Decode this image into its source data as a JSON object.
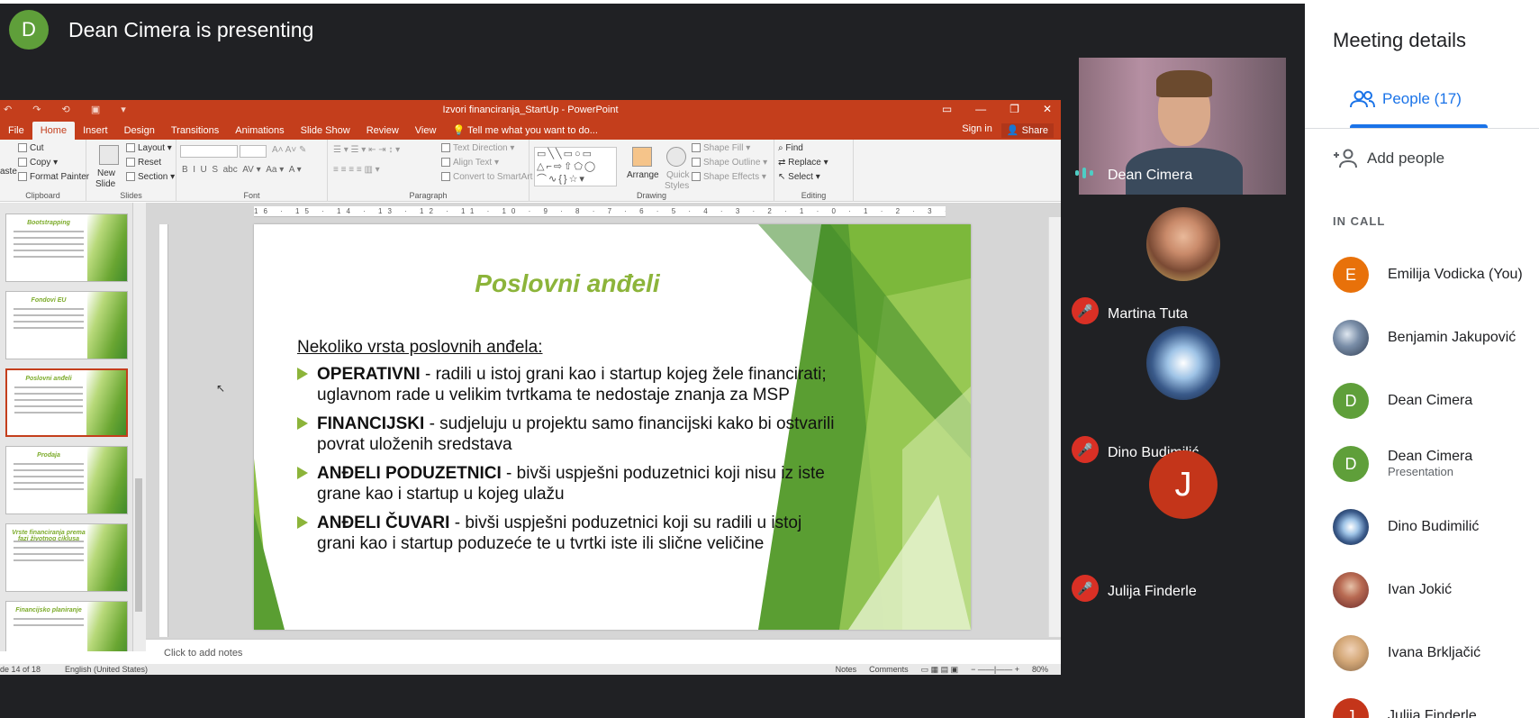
{
  "presenter": {
    "initial": "D",
    "title": "Dean Cimera is presenting"
  },
  "ppt": {
    "doc_title": "Izvori financiranja_StartUp - PowerPoint",
    "qat": "↶ ↷ ⟲ ▣ ▾",
    "tabs": [
      "File",
      "Home",
      "Insert",
      "Design",
      "Transitions",
      "Animations",
      "Slide Show",
      "Review",
      "View"
    ],
    "tell_me": "Tell me what you want to do...",
    "sign_in": "Sign in",
    "share": "Share",
    "clipboard": {
      "cut": "Cut",
      "copy": "Copy",
      "format_painter": "Format Painter",
      "paste": "aste",
      "label": "Clipboard"
    },
    "slides": {
      "new_slide": "New",
      "new_slide2": "Slide",
      "layout": "Layout",
      "reset": "Reset",
      "section": "Section",
      "label": "Slides"
    },
    "font": {
      "label": "Font"
    },
    "paragraph": {
      "text_direction": "Text Direction",
      "align_text": "Align Text",
      "convert": "Convert to SmartArt",
      "label": "Paragraph"
    },
    "drawing": {
      "arrange": "Arrange",
      "quick_styles": "Quick",
      "quick_styles2": "Styles",
      "shape_fill": "Shape Fill",
      "shape_outline": "Shape Outline",
      "shape_effects": "Shape Effects",
      "label": "Drawing"
    },
    "editing": {
      "find": "Find",
      "replace": "Replace",
      "select": "Select",
      "label": "Editing"
    },
    "ruler": "16 · 15 · 14 · 13 · 12 · 11 · 10 · 9 · 8 · 7 · 6 · 5 · 4 · 3 · 2 · 1 · 0 · 1 · 2 · 3 · 4 · 5 · 6 · 7 · 8 · 9 · 10 · 11 · 12 · 13 · 14 · 15 · 16",
    "thumbnails": [
      "Bootstrapping",
      "Fondovi EU",
      "Poslovni anđeli",
      "Prodaja",
      "Vrste financiranja prema fazi životnog ciklusa",
      "Financijsko planiranje"
    ],
    "slide": {
      "title": "Poslovni anđeli",
      "subhead": "Nekoliko vrsta poslovnih anđela:",
      "bullets": [
        {
          "head": "OPERATIVNI",
          "text": " - radili u istoj grani kao i startup kojeg žele financirati; uglavnom rade u velikim tvrtkama te nedostaje znanja za MSP"
        },
        {
          "head": "FINANCIJSKI",
          "text": " - sudjeluju u projektu samo financijski kako bi ostvarili povrat uloženih sredstava"
        },
        {
          "head": "ANĐELI PODUZETNICI",
          "text": " - bivši uspješni poduzetnici koji nisu iz iste grane kao i startup u kojeg ulažu"
        },
        {
          "head": "ANĐELI ČUVARI",
          "text": " - bivši uspješni poduzetnici koji su radili u istoj grani kao i startup poduzeće te u tvrtki iste ili slične veličine"
        }
      ]
    },
    "notes_placeholder": "Click to add notes",
    "status": {
      "slide_of": "de 14 of 18",
      "language": "English (United States)",
      "notes": "Notes",
      "comments": "Comments",
      "zoom": "80%"
    }
  },
  "tiles": [
    {
      "name": "Dean Cimera",
      "type": "video",
      "muted": false
    },
    {
      "name": "Martina Tuta",
      "type": "photo",
      "muted": true
    },
    {
      "name": "Dino Budimilić",
      "type": "photo",
      "muted": true
    },
    {
      "name": "Julija Finderle",
      "type": "initial",
      "initial": "J",
      "color": "#c4351a",
      "muted": true
    }
  ],
  "panel": {
    "title": "Meeting details",
    "people_tab": "People (17)",
    "add_people": "Add people",
    "in_call": "IN CALL",
    "participants": [
      {
        "name": "Emilija Vodicka (You)",
        "initial": "E",
        "color": "#e8710a",
        "kind": "initial"
      },
      {
        "name": "Benjamin Jakupović",
        "kind": "photo"
      },
      {
        "name": "Dean Cimera",
        "initial": "D",
        "color": "#5f9f3a",
        "kind": "initial"
      },
      {
        "name": "Dean Cimera",
        "sub": "Presentation",
        "initial": "D",
        "color": "#5f9f3a",
        "kind": "initial"
      },
      {
        "name": "Dino Budimilić",
        "kind": "photo"
      },
      {
        "name": "Ivan Jokić",
        "kind": "photo"
      },
      {
        "name": "Ivana Brkljačić",
        "kind": "photo"
      },
      {
        "name": "Julija Finderle",
        "initial": "J",
        "color": "#c4351a",
        "kind": "initial"
      }
    ]
  },
  "colors": {
    "ppt_accent": "#c43e1c",
    "slide_green": "#8cb43a",
    "meet_blue": "#1a73e8",
    "mute_red": "#d93025"
  }
}
